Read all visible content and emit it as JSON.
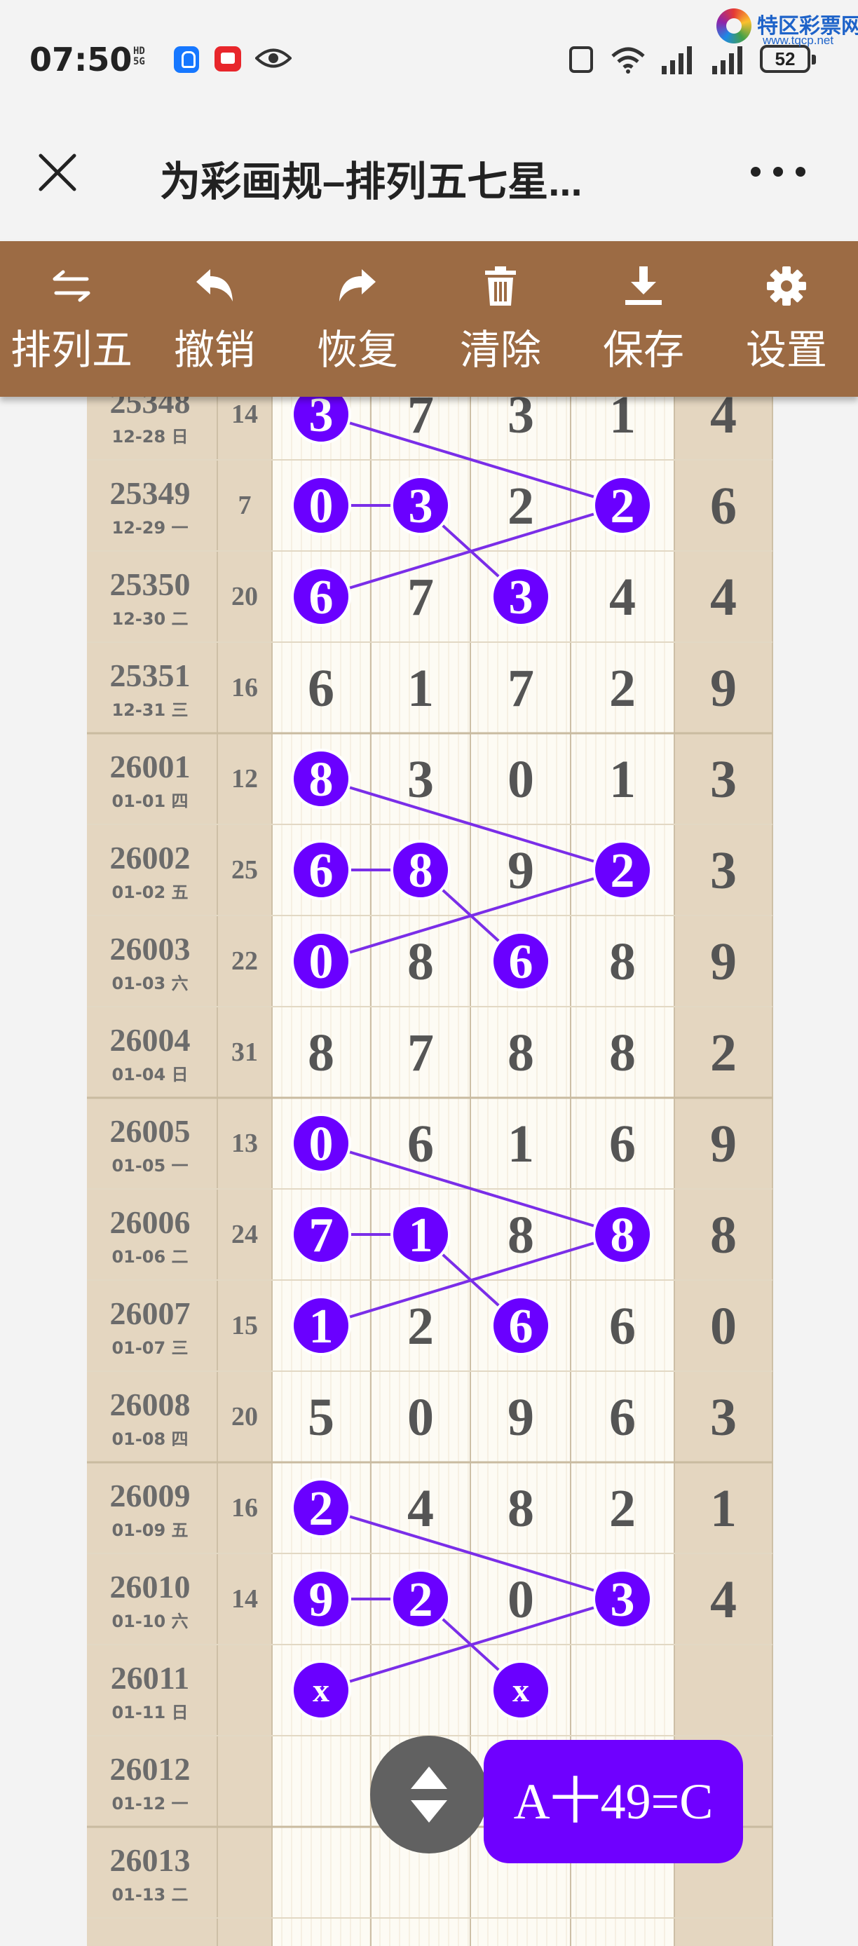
{
  "status_bar": {
    "time": "07:50",
    "hd_top": "HD",
    "hd_bottom": "5G",
    "battery": "52"
  },
  "watermark": {
    "name": "特区彩票网",
    "url": "www.tqcp.net"
  },
  "header": {
    "title": "为彩画规–排列五七星..."
  },
  "toolbar": {
    "items": [
      {
        "label": "排列五",
        "icon": "swap-arrows-icon"
      },
      {
        "label": "撤销",
        "icon": "undo-icon"
      },
      {
        "label": "恢复",
        "icon": "redo-icon"
      },
      {
        "label": "清除",
        "icon": "trash-icon"
      },
      {
        "label": "保存",
        "icon": "download-icon"
      },
      {
        "label": "设置",
        "icon": "gear-icon"
      }
    ]
  },
  "table": {
    "rows": [
      {
        "issue": "25348",
        "date": "12-28 日",
        "sum": "14",
        "digits": [
          "3",
          "7",
          "3",
          "1",
          "4"
        ]
      },
      {
        "issue": "25349",
        "date": "12-29 一",
        "sum": "7",
        "digits": [
          "0",
          "3",
          "2",
          "2",
          "6"
        ]
      },
      {
        "issue": "25350",
        "date": "12-30 二",
        "sum": "20",
        "digits": [
          "6",
          "7",
          "3",
          "4",
          "4"
        ]
      },
      {
        "issue": "25351",
        "date": "12-31 三",
        "sum": "16",
        "digits": [
          "6",
          "1",
          "7",
          "2",
          "9"
        ]
      },
      {
        "issue": "26001",
        "date": "01-01 四",
        "sum": "12",
        "digits": [
          "8",
          "3",
          "0",
          "1",
          "3"
        ]
      },
      {
        "issue": "26002",
        "date": "01-02 五",
        "sum": "25",
        "digits": [
          "6",
          "8",
          "9",
          "2",
          "3"
        ]
      },
      {
        "issue": "26003",
        "date": "01-03 六",
        "sum": "22",
        "digits": [
          "0",
          "8",
          "6",
          "8",
          "9"
        ]
      },
      {
        "issue": "26004",
        "date": "01-04 日",
        "sum": "31",
        "digits": [
          "8",
          "7",
          "8",
          "8",
          "2"
        ]
      },
      {
        "issue": "26005",
        "date": "01-05 一",
        "sum": "13",
        "digits": [
          "0",
          "6",
          "1",
          "6",
          "9"
        ]
      },
      {
        "issue": "26006",
        "date": "01-06 二",
        "sum": "24",
        "digits": [
          "7",
          "1",
          "8",
          "8",
          "8"
        ]
      },
      {
        "issue": "26007",
        "date": "01-07 三",
        "sum": "15",
        "digits": [
          "1",
          "2",
          "6",
          "6",
          "0"
        ]
      },
      {
        "issue": "26008",
        "date": "01-08 四",
        "sum": "20",
        "digits": [
          "5",
          "0",
          "9",
          "6",
          "3"
        ]
      },
      {
        "issue": "26009",
        "date": "01-09 五",
        "sum": "16",
        "digits": [
          "2",
          "4",
          "8",
          "2",
          "1"
        ]
      },
      {
        "issue": "26010",
        "date": "01-10 六",
        "sum": "14",
        "digits": [
          "9",
          "2",
          "0",
          "3",
          "4"
        ]
      },
      {
        "issue": "26011",
        "date": "01-11 日",
        "sum": "",
        "digits": [
          "x",
          "",
          "x",
          "",
          ""
        ]
      },
      {
        "issue": "26012",
        "date": "01-12 一",
        "sum": "",
        "digits": [
          "",
          "",
          "",
          "",
          ""
        ]
      },
      {
        "issue": "26013",
        "date": "01-13 二",
        "sum": "",
        "digits": [
          "",
          "",
          "",
          "",
          ""
        ]
      }
    ],
    "highlights": [
      [
        0,
        0
      ],
      [
        1,
        0
      ],
      [
        1,
        1
      ],
      [
        1,
        3
      ],
      [
        2,
        0
      ],
      [
        2,
        2
      ],
      [
        4,
        0
      ],
      [
        5,
        0
      ],
      [
        5,
        1
      ],
      [
        5,
        3
      ],
      [
        6,
        0
      ],
      [
        6,
        2
      ],
      [
        8,
        0
      ],
      [
        9,
        0
      ],
      [
        9,
        1
      ],
      [
        9,
        3
      ],
      [
        10,
        0
      ],
      [
        10,
        2
      ],
      [
        12,
        0
      ],
      [
        13,
        0
      ],
      [
        13,
        1
      ],
      [
        13,
        3
      ],
      [
        14,
        0
      ],
      [
        14,
        2
      ]
    ],
    "lines": [
      [
        [
          0,
          0
        ],
        [
          1,
          3
        ]
      ],
      [
        [
          1,
          3
        ],
        [
          2,
          0
        ]
      ],
      [
        [
          1,
          0
        ],
        [
          1,
          1
        ]
      ],
      [
        [
          1,
          1
        ],
        [
          2,
          2
        ]
      ],
      [
        [
          4,
          0
        ],
        [
          5,
          3
        ]
      ],
      [
        [
          5,
          3
        ],
        [
          6,
          0
        ]
      ],
      [
        [
          5,
          0
        ],
        [
          5,
          1
        ]
      ],
      [
        [
          5,
          1
        ],
        [
          6,
          2
        ]
      ],
      [
        [
          8,
          0
        ],
        [
          9,
          3
        ]
      ],
      [
        [
          9,
          3
        ],
        [
          10,
          0
        ]
      ],
      [
        [
          9,
          0
        ],
        [
          9,
          1
        ]
      ],
      [
        [
          9,
          1
        ],
        [
          10,
          2
        ]
      ],
      [
        [
          12,
          0
        ],
        [
          13,
          3
        ]
      ],
      [
        [
          13,
          3
        ],
        [
          14,
          0
        ]
      ],
      [
        [
          13,
          0
        ],
        [
          13,
          1
        ]
      ],
      [
        [
          13,
          1
        ],
        [
          14,
          2
        ]
      ]
    ],
    "colors": {
      "ball": "#6a00ff",
      "line": "#7a2ee8",
      "side_bg": "#e4d6c0",
      "grid_bg": "#fdfbf4",
      "digit": "#555555",
      "issue": "#6b6b6b"
    }
  },
  "formula_button": {
    "label": "A十49=C"
  }
}
